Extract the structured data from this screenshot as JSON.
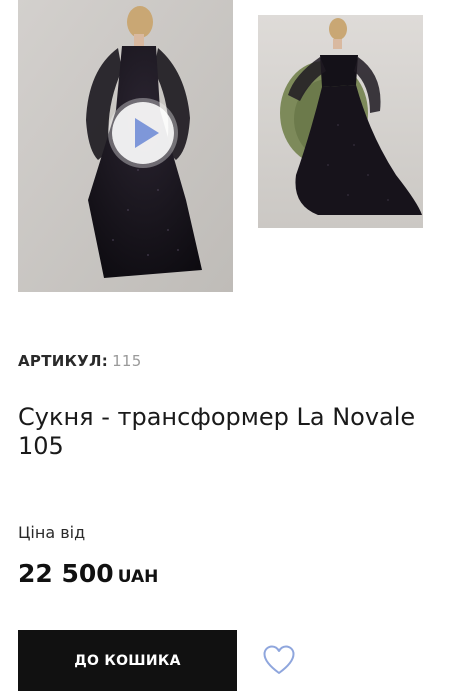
{
  "gallery": {
    "main_image_alt": "dress-back-view",
    "second_image_alt": "dress-seated-view",
    "play_icon": "play-icon"
  },
  "product": {
    "sku_label": "АРТИКУЛ:",
    "sku_value": "115",
    "title": "Сукня - трансформер La Novale 105",
    "price_label": "Ціна від",
    "price_amount": "22 500",
    "price_currency": "UAH"
  },
  "actions": {
    "add_to_cart_label": "ДО КОШИКА",
    "wishlist_icon": "heart-icon"
  },
  "colors": {
    "button_bg": "#111111",
    "heart": "#8fa6dd",
    "play": "#7e97d9"
  }
}
